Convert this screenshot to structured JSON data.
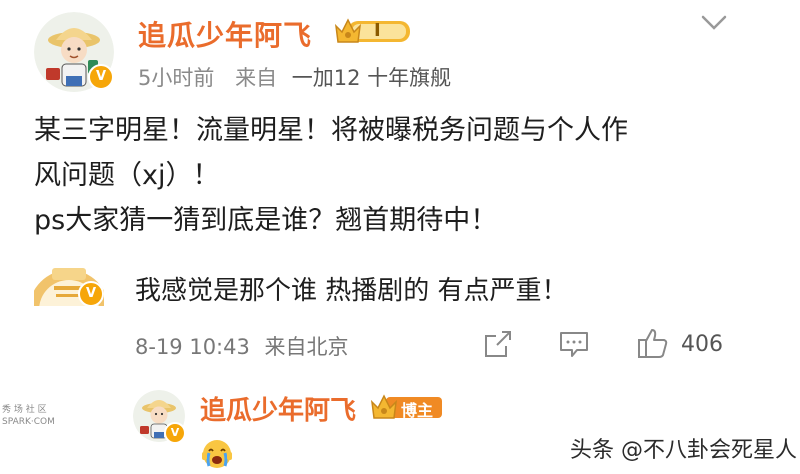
{
  "post": {
    "author": "追瓜少年阿飞",
    "level_badge": "I",
    "time": "5小时前",
    "source_prefix": "来自",
    "device": "一加12 十年旗舰",
    "text_lines": [
      "某三字明星！流量明星！将被曝税务问题与个人作",
      "风问题（xj）！",
      "ps大家猜一猜到底是谁？翘首期待中！"
    ]
  },
  "comment": {
    "text": "我感觉是那个谁 热播剧的 有点严重！",
    "datetime": "8-19 10:43",
    "location": "来自北京",
    "likes": "406"
  },
  "reply": {
    "author": "追瓜少年阿飞",
    "badge": "博主"
  },
  "watermark": {
    "left_line1": "秀 场 社 区",
    "left_line2": "SPARK·COM",
    "right": "头条 @不八卦会死星人"
  },
  "colors": {
    "author_name": "#ea6c2c",
    "vip_badge": "#f6a609",
    "meta_text": "#8a8a8a"
  },
  "icons": [
    "chevron-down-icon",
    "share-icon",
    "comment-icon",
    "like-icon",
    "crown-icon",
    "verified-icon",
    "crying-emoji-icon"
  ]
}
